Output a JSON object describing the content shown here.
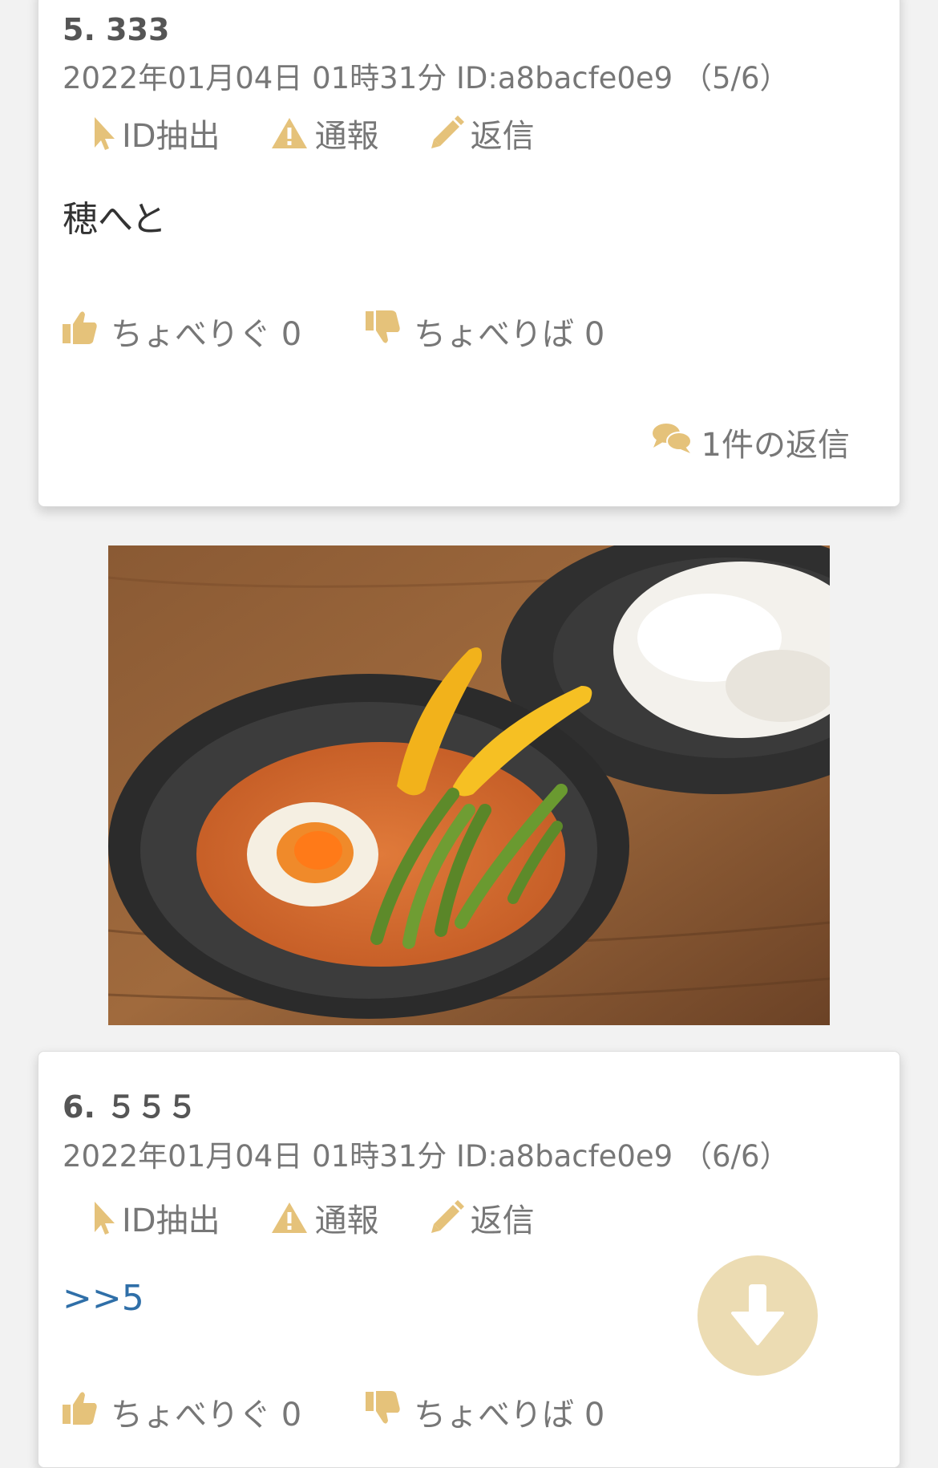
{
  "colors": {
    "accent": "#e5c27a",
    "link": "#2f6fa8",
    "meta": "#777777",
    "scroll_button": "#ecdcb3"
  },
  "posts": [
    {
      "number": "5. 333",
      "meta": "2022年01月04日 01時31分 ID:a8bacfe0e9 （5/6）",
      "actions": {
        "extract": "ID抽出",
        "report": "通報",
        "reply": "返信"
      },
      "body": "穂へと",
      "votes": {
        "good_label": "ちょべりぐ",
        "good_count": "0",
        "bad_label": "ちょべりば",
        "bad_count": "0"
      },
      "replies": "1件の返信"
    },
    {
      "number": "6. ５５５",
      "meta": "2022年01月04日 01時31分 ID:a8bacfe0e9 （6/6）",
      "actions": {
        "extract": "ID抽出",
        "report": "通報",
        "reply": "返信"
      },
      "body_link": ">>5",
      "votes": {
        "good_label": "ちょべりぐ",
        "good_count": "0",
        "bad_label": "ちょべりば",
        "bad_count": "0"
      }
    }
  ],
  "icons": [
    "cursor-icon",
    "warning-icon",
    "pencil-icon",
    "thumbs-up-icon",
    "thumbs-down-icon",
    "comments-icon",
    "arrow-down-icon"
  ]
}
